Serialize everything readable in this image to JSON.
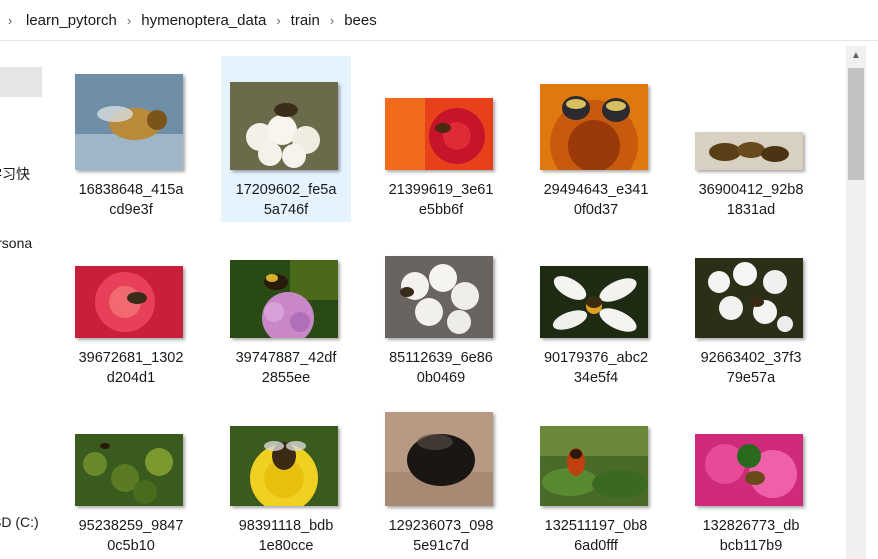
{
  "breadcrumb": {
    "segments": [
      "learn_pytorch",
      "hymenoptera_data",
      "train",
      "bees"
    ]
  },
  "nav": {
    "items": [
      "学习快",
      "Persona",
      "SD (C:)"
    ]
  },
  "files": [
    {
      "line1": "16838648_415a",
      "line2": "cd9e3f"
    },
    {
      "line1": "17209602_fe5a",
      "line2": "5a746f",
      "selected": true
    },
    {
      "line1": "21399619_3e61",
      "line2": "e5bb6f"
    },
    {
      "line1": "29494643_e341",
      "line2": "0f0d37"
    },
    {
      "line1": "36900412_92b8",
      "line2": "1831ad"
    },
    {
      "line1": "39672681_1302",
      "line2": "d204d1"
    },
    {
      "line1": "39747887_42df",
      "line2": "2855ee"
    },
    {
      "line1": "85112639_6e86",
      "line2": "0b0469"
    },
    {
      "line1": "90179376_abc2",
      "line2": "34e5f4"
    },
    {
      "line1": "92663402_37f3",
      "line2": "79e57a"
    },
    {
      "line1": "95238259_9847",
      "line2": "0c5b10"
    },
    {
      "line1": "98391118_bdb",
      "line2": "1e80cce"
    },
    {
      "line1": "129236073_098",
      "line2": "5e91c7d"
    },
    {
      "line1": "132511197_0b8",
      "line2": "6ad0fff"
    },
    {
      "line1": "132826773_db",
      "line2": "bcb117b9"
    }
  ],
  "colors": {
    "selection": "#e5f3ff",
    "nav_selected": "#e5e5e5",
    "scroll_thumb": "#c2c2c2"
  }
}
